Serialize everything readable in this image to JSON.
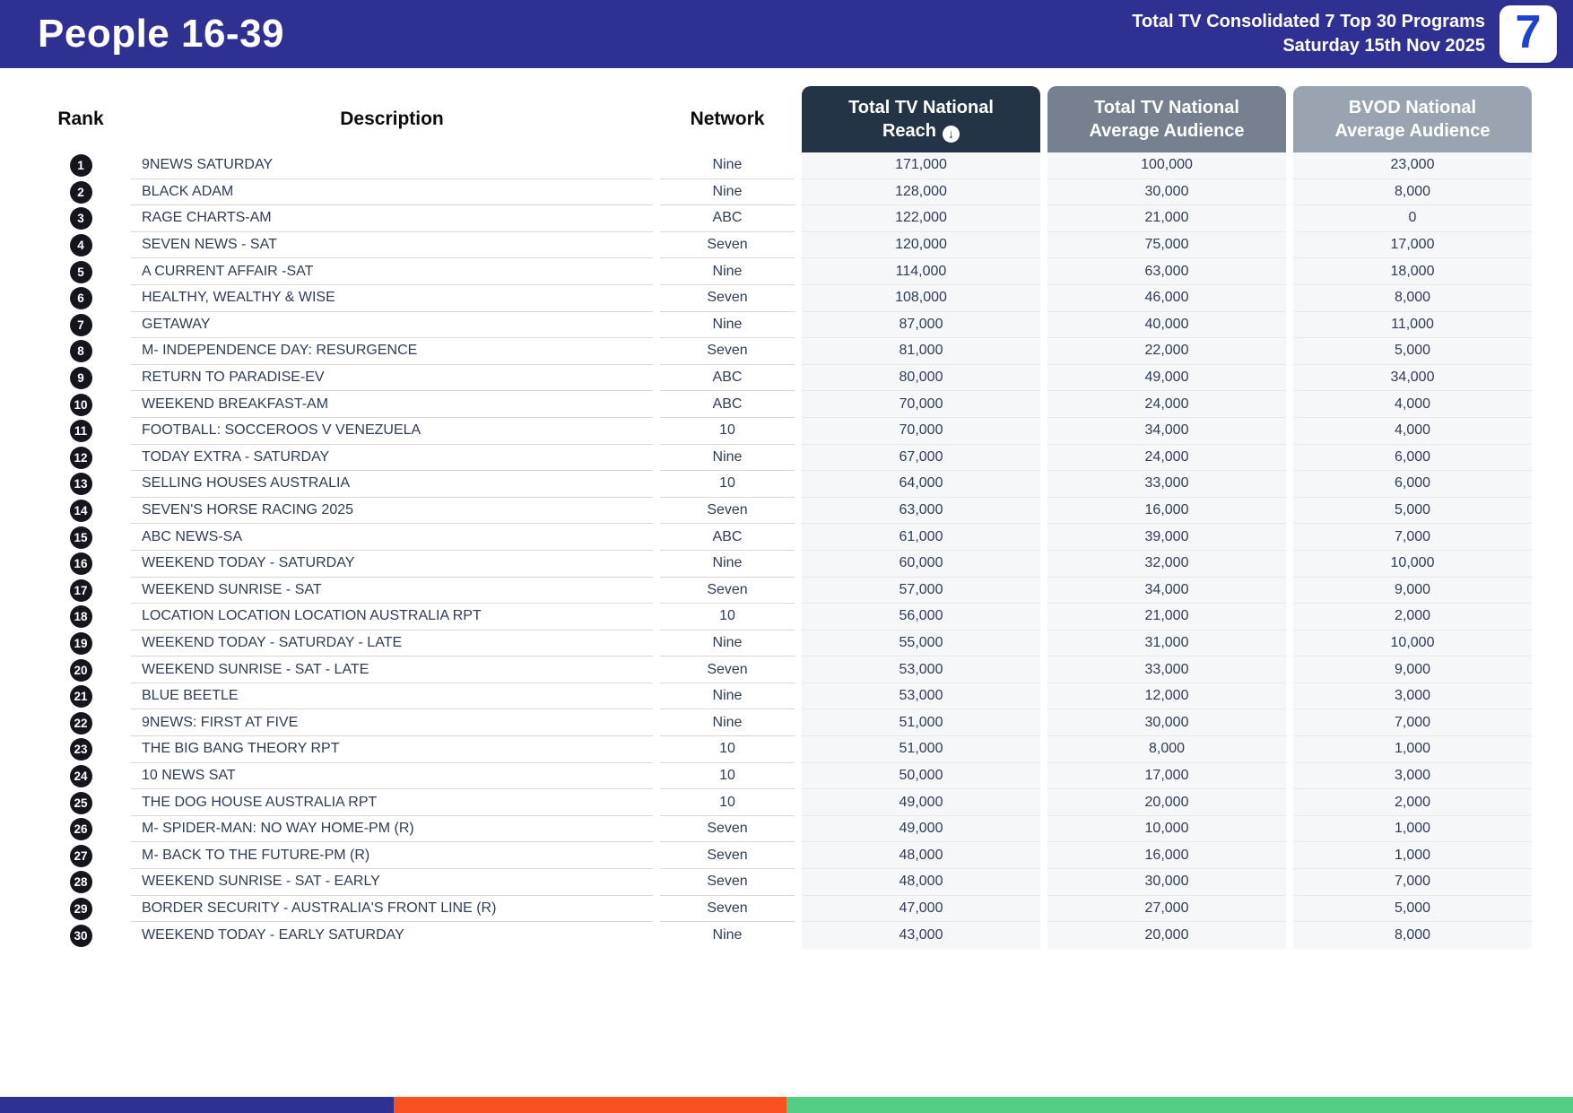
{
  "header": {
    "title": "People 16-39",
    "subtitle_line1": "Total TV Consolidated 7 Top 30 Programs",
    "subtitle_line2": "Saturday 15th Nov 2025",
    "logo_text": "7"
  },
  "table": {
    "columns": {
      "rank": "Rank",
      "description": "Description",
      "network": "Network",
      "reach": "Total TV National Reach",
      "avg_audience": "Total TV National Average Audience",
      "bvod_audience": "BVOD National Average Audience"
    },
    "sort": {
      "column": "Total TV National Reach",
      "direction": "descending",
      "icon": "arrow-down-circle-icon"
    },
    "rows": [
      {
        "rank": "1",
        "description": "9NEWS SATURDAY",
        "network": "Nine",
        "reach": "171,000",
        "avg": "100,000",
        "bvod": "23,000"
      },
      {
        "rank": "2",
        "description": "BLACK ADAM",
        "network": "Nine",
        "reach": "128,000",
        "avg": "30,000",
        "bvod": "8,000"
      },
      {
        "rank": "3",
        "description": "RAGE CHARTS-AM",
        "network": "ABC",
        "reach": "122,000",
        "avg": "21,000",
        "bvod": "0"
      },
      {
        "rank": "4",
        "description": "SEVEN NEWS - SAT",
        "network": "Seven",
        "reach": "120,000",
        "avg": "75,000",
        "bvod": "17,000"
      },
      {
        "rank": "5",
        "description": "A CURRENT AFFAIR -SAT",
        "network": "Nine",
        "reach": "114,000",
        "avg": "63,000",
        "bvod": "18,000"
      },
      {
        "rank": "6",
        "description": "HEALTHY, WEALTHY & WISE",
        "network": "Seven",
        "reach": "108,000",
        "avg": "46,000",
        "bvod": "8,000"
      },
      {
        "rank": "7",
        "description": "GETAWAY",
        "network": "Nine",
        "reach": "87,000",
        "avg": "40,000",
        "bvod": "11,000"
      },
      {
        "rank": "8",
        "description": "M- INDEPENDENCE DAY: RESURGENCE",
        "network": "Seven",
        "reach": "81,000",
        "avg": "22,000",
        "bvod": "5,000"
      },
      {
        "rank": "9",
        "description": "RETURN TO PARADISE-EV",
        "network": "ABC",
        "reach": "80,000",
        "avg": "49,000",
        "bvod": "34,000"
      },
      {
        "rank": "10",
        "description": "WEEKEND BREAKFAST-AM",
        "network": "ABC",
        "reach": "70,000",
        "avg": "24,000",
        "bvod": "4,000"
      },
      {
        "rank": "11",
        "description": "FOOTBALL: SOCCEROOS V VENEZUELA",
        "network": "10",
        "reach": "70,000",
        "avg": "34,000",
        "bvod": "4,000"
      },
      {
        "rank": "12",
        "description": "TODAY EXTRA - SATURDAY",
        "network": "Nine",
        "reach": "67,000",
        "avg": "24,000",
        "bvod": "6,000"
      },
      {
        "rank": "13",
        "description": "SELLING HOUSES AUSTRALIA",
        "network": "10",
        "reach": "64,000",
        "avg": "33,000",
        "bvod": "6,000"
      },
      {
        "rank": "14",
        "description": "SEVEN'S HORSE RACING 2025",
        "network": "Seven",
        "reach": "63,000",
        "avg": "16,000",
        "bvod": "5,000"
      },
      {
        "rank": "15",
        "description": "ABC NEWS-SA",
        "network": "ABC",
        "reach": "61,000",
        "avg": "39,000",
        "bvod": "7,000"
      },
      {
        "rank": "16",
        "description": "WEEKEND TODAY - SATURDAY",
        "network": "Nine",
        "reach": "60,000",
        "avg": "32,000",
        "bvod": "10,000"
      },
      {
        "rank": "17",
        "description": "WEEKEND SUNRISE - SAT",
        "network": "Seven",
        "reach": "57,000",
        "avg": "34,000",
        "bvod": "9,000"
      },
      {
        "rank": "18",
        "description": "LOCATION LOCATION LOCATION AUSTRALIA RPT",
        "network": "10",
        "reach": "56,000",
        "avg": "21,000",
        "bvod": "2,000"
      },
      {
        "rank": "19",
        "description": "WEEKEND TODAY - SATURDAY - LATE",
        "network": "Nine",
        "reach": "55,000",
        "avg": "31,000",
        "bvod": "10,000"
      },
      {
        "rank": "20",
        "description": "WEEKEND SUNRISE - SAT - LATE",
        "network": "Seven",
        "reach": "53,000",
        "avg": "33,000",
        "bvod": "9,000"
      },
      {
        "rank": "21",
        "description": "BLUE BEETLE",
        "network": "Nine",
        "reach": "53,000",
        "avg": "12,000",
        "bvod": "3,000"
      },
      {
        "rank": "22",
        "description": "9NEWS: FIRST AT FIVE",
        "network": "Nine",
        "reach": "51,000",
        "avg": "30,000",
        "bvod": "7,000"
      },
      {
        "rank": "23",
        "description": "THE BIG BANG THEORY RPT",
        "network": "10",
        "reach": "51,000",
        "avg": "8,000",
        "bvod": "1,000"
      },
      {
        "rank": "24",
        "description": "10 NEWS SAT",
        "network": "10",
        "reach": "50,000",
        "avg": "17,000",
        "bvod": "3,000"
      },
      {
        "rank": "25",
        "description": "THE DOG HOUSE AUSTRALIA RPT",
        "network": "10",
        "reach": "49,000",
        "avg": "20,000",
        "bvod": "2,000"
      },
      {
        "rank": "26",
        "description": "M- SPIDER-MAN: NO WAY HOME-PM (R)",
        "network": "Seven",
        "reach": "49,000",
        "avg": "10,000",
        "bvod": "1,000"
      },
      {
        "rank": "27",
        "description": "M- BACK TO THE FUTURE-PM (R)",
        "network": "Seven",
        "reach": "48,000",
        "avg": "16,000",
        "bvod": "1,000"
      },
      {
        "rank": "28",
        "description": "WEEKEND SUNRISE - SAT - EARLY",
        "network": "Seven",
        "reach": "48,000",
        "avg": "30,000",
        "bvod": "7,000"
      },
      {
        "rank": "29",
        "description": "BORDER SECURITY - AUSTRALIA'S FRONT LINE (R)",
        "network": "Seven",
        "reach": "47,000",
        "avg": "27,000",
        "bvod": "5,000"
      },
      {
        "rank": "30",
        "description": "WEEKEND TODAY - EARLY SATURDAY",
        "network": "Nine",
        "reach": "43,000",
        "avg": "20,000",
        "bvod": "8,000"
      }
    ]
  },
  "colors": {
    "topbar": "#2e3192",
    "pill_reach": "#243447",
    "pill_avg": "#76808f",
    "pill_bvod": "#9aa4b1",
    "footer_blue": "#2e3192",
    "footer_orange": "#f95020",
    "footer_green": "#53cd84",
    "logo_seven_blue": "#1c43cc"
  },
  "footer": {
    "segments": [
      {
        "color": "#2e3192",
        "width_percent": 25
      },
      {
        "color": "#f95020",
        "width_percent": 25
      },
      {
        "color": "#53cd84",
        "width_percent": 50
      }
    ]
  }
}
